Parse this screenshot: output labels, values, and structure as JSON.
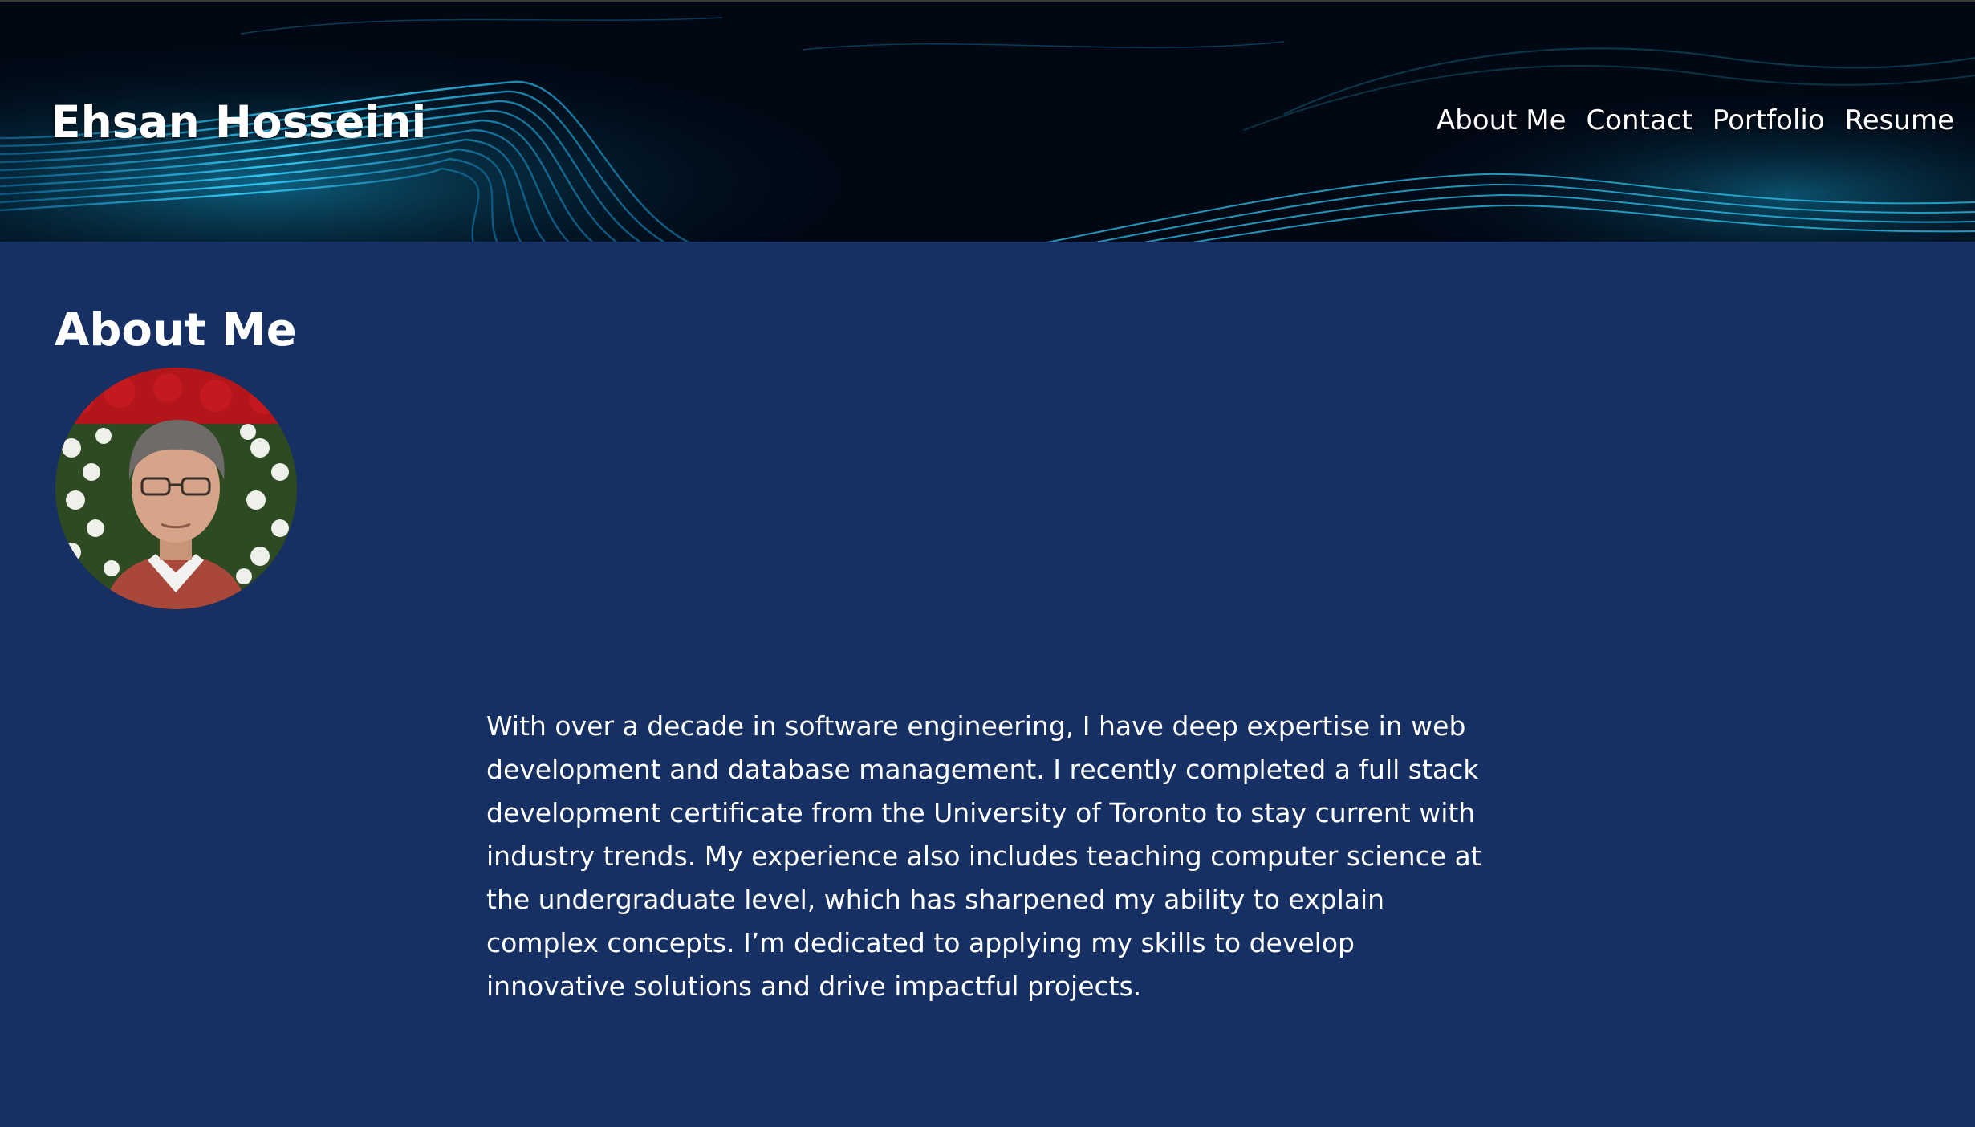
{
  "header": {
    "site_title": "Ehsan Hosseini",
    "nav": [
      {
        "label": "About Me"
      },
      {
        "label": "Contact"
      },
      {
        "label": "Portfolio"
      },
      {
        "label": "Resume"
      }
    ]
  },
  "about": {
    "heading": "About Me",
    "bio": "With over a decade in software engineering, I have deep expertise in web development and database management. I recently completed a full stack development certificate from the University of Toronto to stay current with industry trends. My experience also includes teaching computer science at the undergraduate level, which has sharpened my ability to explain complex concepts. I’m dedicated to applying my skills to develop innovative solutions and drive impactful projects."
  },
  "colors": {
    "page_background": "#163063",
    "header_background": "#000814",
    "accent_wave": "#29c4f0",
    "text": "#ffffff"
  }
}
